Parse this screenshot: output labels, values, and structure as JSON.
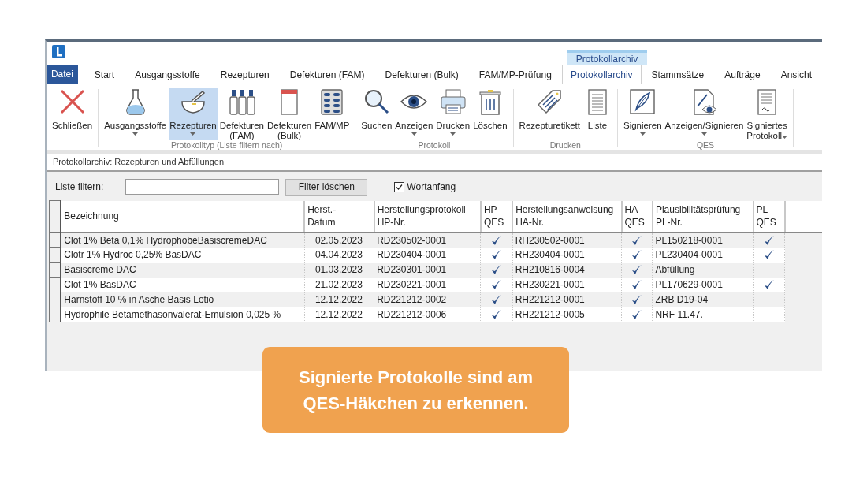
{
  "window": {
    "contextual_tab": "Protokollarchiv",
    "tabs": [
      {
        "label": "Datei",
        "kind": "file",
        "selected": false
      },
      {
        "label": "Start",
        "kind": "tab",
        "selected": false
      },
      {
        "label": "Ausgangsstoffe",
        "kind": "tab",
        "selected": false
      },
      {
        "label": "Rezepturen",
        "kind": "tab",
        "selected": false
      },
      {
        "label": "Defekturen (FAM)",
        "kind": "tab",
        "selected": false
      },
      {
        "label": "Defekturen (Bulk)",
        "kind": "tab",
        "selected": false
      },
      {
        "label": "FAM/MP-Prüfung",
        "kind": "tab",
        "selected": false
      },
      {
        "label": "Protokollarchiv",
        "kind": "tab",
        "selected": true
      },
      {
        "label": "Stammsätze",
        "kind": "tab",
        "selected": false
      },
      {
        "label": "Aufträge",
        "kind": "tab",
        "selected": false
      },
      {
        "label": "Ansicht",
        "kind": "tab",
        "selected": false
      }
    ],
    "ribbon_groups": [
      {
        "buttons": [
          {
            "label": [
              "Schließen"
            ],
            "kind": "close",
            "selected": false
          }
        ]
      },
      {
        "label": "Protokolltyp (Liste filtern nach)",
        "buttons": [
          {
            "label": [
              "Ausgangsstoffe"
            ],
            "kind": "flask",
            "dropdown": true,
            "selected": false
          },
          {
            "label": [
              "Rezepturen"
            ],
            "kind": "mortar",
            "dropdown": true,
            "selected": true
          },
          {
            "label": [
              "Defekturen",
              "(FAM)"
            ],
            "kind": "bottles",
            "selected": false
          },
          {
            "label": [
              "Defekturen",
              "(Bulk)"
            ],
            "kind": "box",
            "selected": false
          },
          {
            "label": [
              "FAM/MP"
            ],
            "kind": "blister",
            "selected": false
          }
        ]
      },
      {
        "label": "Protokoll",
        "buttons": [
          {
            "label": [
              "Suchen"
            ],
            "kind": "search",
            "selected": false
          },
          {
            "label": [
              "Anzeigen"
            ],
            "kind": "eye",
            "dropdown": true,
            "selected": false
          },
          {
            "label": [
              "Drucken"
            ],
            "kind": "printer",
            "dropdown": true,
            "selected": false
          },
          {
            "label": [
              "Löschen"
            ],
            "kind": "trash",
            "selected": false
          }
        ]
      },
      {
        "label": "Drucken",
        "buttons": [
          {
            "label": [
              "Rezepturetikett"
            ],
            "kind": "tag",
            "selected": false
          },
          {
            "label": [
              "Liste"
            ],
            "kind": "list",
            "selected": false
          }
        ]
      },
      {
        "label": "QES",
        "buttons": [
          {
            "label": [
              "Signieren"
            ],
            "kind": "pen",
            "dropdown": true,
            "selected": false
          },
          {
            "label": [
              "Anzeigen/Signieren"
            ],
            "kind": "doceye",
            "dropdown": true,
            "selected": false
          },
          {
            "label": [
              "Signiertes",
              "Protokoll"
            ],
            "kind": "signed",
            "dropdown": true,
            "selected": false
          }
        ]
      }
    ],
    "caption": "Protokollarchiv: Rezepturen und Abfüllungen"
  },
  "filter": {
    "label": "Liste filtern:",
    "button": "Filter löschen",
    "checkbox": {
      "label": "Wortanfang",
      "checked": true
    }
  },
  "table": {
    "columns": [
      [
        "Bezeichnung"
      ],
      [
        "Herst.-",
        "Datum"
      ],
      [
        "Herstellungsprotokoll",
        "HP-Nr."
      ],
      [
        "HP",
        "QES"
      ],
      [
        "Herstellungsanweisung",
        "HA-Nr."
      ],
      [
        "HA",
        "QES"
      ],
      [
        "Plausibilitätsprüfung",
        "PL-Nr."
      ],
      [
        "PL",
        "QES"
      ]
    ],
    "rows": [
      {
        "bezeichnung": "Clot 1% Beta 0,1% HydrophobeBasiscremeDAC",
        "datum": "02.05.2023",
        "hp_nr": "RD230502-0001",
        "hp_qes": true,
        "ha_nr": "RH230502-0001",
        "ha_qes": true,
        "pl_nr": "PL150218-0001",
        "pl_qes": true
      },
      {
        "bezeichnung": "Clotr 1% Hydroc 0,25% BasDAC",
        "datum": "04.04.2023",
        "hp_nr": "RD230404-0001",
        "hp_qes": true,
        "ha_nr": "RH230404-0001",
        "ha_qes": true,
        "pl_nr": "PL230404-0001",
        "pl_qes": true
      },
      {
        "bezeichnung": "Basiscreme DAC",
        "datum": "01.03.2023",
        "hp_nr": "RD230301-0001",
        "hp_qes": true,
        "ha_nr": "RH210816-0004",
        "ha_qes": true,
        "pl_nr": "Abfüllung",
        "pl_qes": false
      },
      {
        "bezeichnung": "Clot 1% BasDAC",
        "datum": "21.02.2023",
        "hp_nr": "RD230221-0001",
        "hp_qes": true,
        "ha_nr": "RH230221-0001",
        "ha_qes": true,
        "pl_nr": "PL170629-0001",
        "pl_qes": true
      },
      {
        "bezeichnung": "Harnstoff 10 % in Asche Basis Lotio",
        "datum": "12.12.2022",
        "hp_nr": "RD221212-0002",
        "hp_qes": true,
        "ha_nr": "RH221212-0001",
        "ha_qes": true,
        "pl_nr": "ZRB D19-04",
        "pl_qes": false
      },
      {
        "bezeichnung": "Hydrophile Betamethasonvalerat-Emulsion 0,025 %",
        "datum": "12.12.2022",
        "hp_nr": "RD221212-0006",
        "hp_qes": true,
        "ha_nr": "RH221212-0005",
        "ha_qes": true,
        "pl_nr": "NRF 11.47.",
        "pl_qes": false
      }
    ]
  },
  "callout": "Signierte Protokolle sind am QES-Häkchen zu erkennen."
}
